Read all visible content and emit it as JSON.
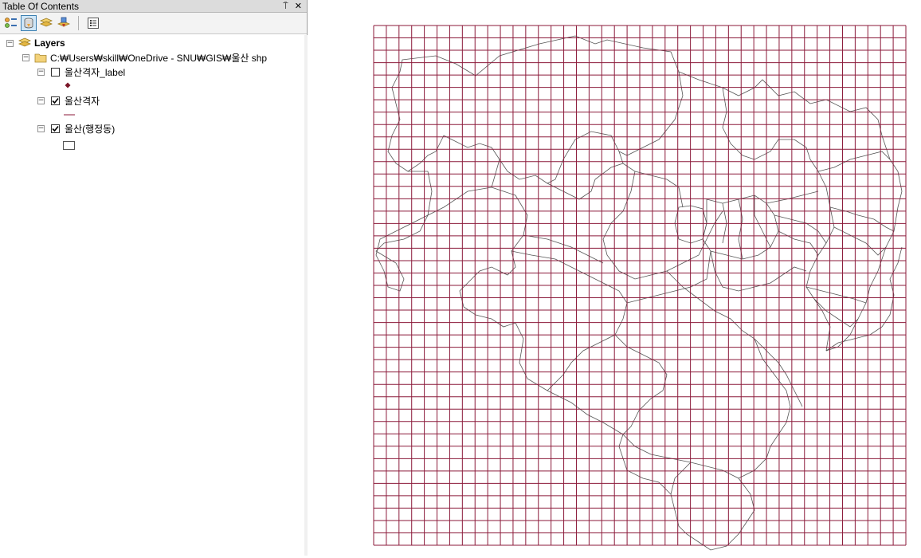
{
  "toc": {
    "title": "Table Of Contents",
    "pin_glyph": "⍑",
    "close_glyph": "✕",
    "toolbar": [
      {
        "icon": "list-by-drawing-order-icon"
      },
      {
        "icon": "list-by-source-icon"
      },
      {
        "icon": "list-by-visibility-icon"
      },
      {
        "icon": "list-by-selection-icon"
      },
      {
        "icon": "options-icon"
      }
    ],
    "root": {
      "label": "Layers",
      "expand": "−"
    },
    "folder": {
      "label": "C:₩Users₩skill₩OneDrive - SNU₩GIS₩울산 shp",
      "expand": "−"
    },
    "layers": [
      {
        "label": "울산격자_label",
        "checked": false,
        "expand": "−",
        "symbol": "point-marker-icon"
      },
      {
        "label": "울산격자",
        "checked": true,
        "expand": "−",
        "symbol": "line-symbol-icon"
      },
      {
        "label": "울산(행정동)",
        "checked": true,
        "expand": "−",
        "symbol": "polygon-symbol-icon"
      }
    ]
  },
  "map": {
    "grid_color": "#8b1a3a",
    "boundary_color": "#555555",
    "grid_columns": 42,
    "grid_rows": 42
  },
  "colors": {
    "toc_background": "#ffffff",
    "title_bar": "#dcdcdc",
    "check_mark": "#000000"
  }
}
